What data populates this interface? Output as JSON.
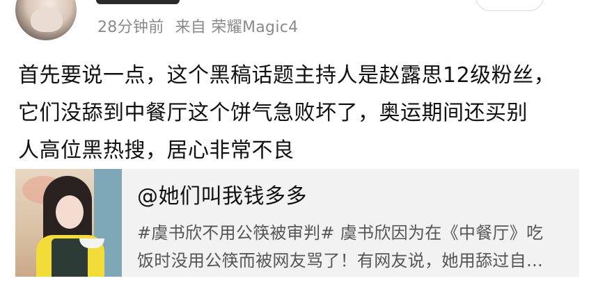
{
  "post": {
    "time": "28分钟前",
    "source": "来自 荣耀Magic4",
    "text_lines": [
      "首先要说一点，这个黑稿话题主持人是赵露思12级粉丝，",
      "它们没舔到中餐厅这个饼气急败坏了，奥运期间还买别",
      "人高位黑热搜，居心非常不良"
    ]
  },
  "repost": {
    "author": "@她们叫我钱多多",
    "snippet_lines": [
      "#虞书欣不用公筷被审判# 虞书欣因为在《中餐厅》吃",
      "饭时没用公筷而被网友骂了！有网友说，她用舔过自…"
    ]
  }
}
